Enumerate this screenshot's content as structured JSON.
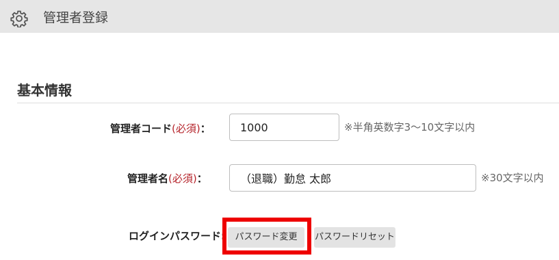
{
  "header": {
    "icon": "gear-icon",
    "title": "管理者登録"
  },
  "section": {
    "title": "基本情報"
  },
  "form": {
    "code": {
      "label": "管理者コード",
      "required": "(必須)",
      "colon": "：",
      "value": "1000",
      "hint": "※半角英数字3～10文字以内"
    },
    "name": {
      "label": "管理者名",
      "required": "(必須)",
      "colon": "：",
      "value": "（退職）勤怠 太郎",
      "hint": "※30文字以内"
    },
    "password": {
      "label": "ログインパスワード:",
      "change_button": "パスワード変更",
      "reset_button": "パスワードリセット"
    }
  },
  "colors": {
    "header_bg": "#e6e6e6",
    "required": "#b5232a",
    "highlight": "#ee0000",
    "button_bg": "#e3e3e3"
  }
}
